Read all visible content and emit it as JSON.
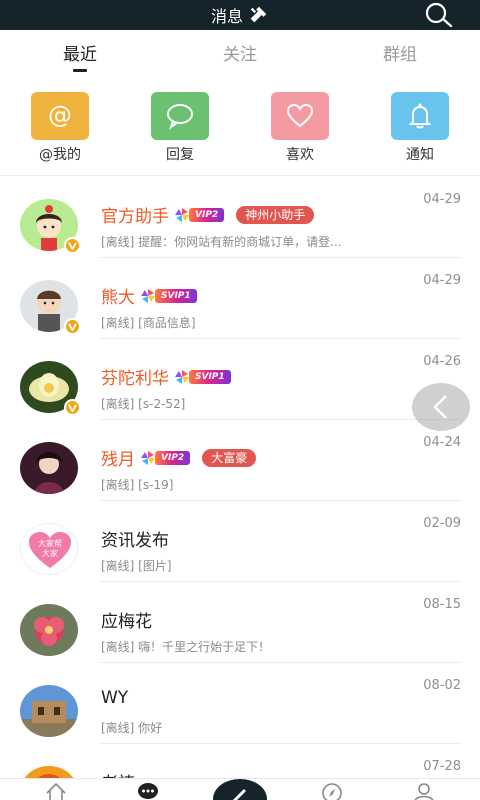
{
  "header": {
    "title": "消息"
  },
  "tabs": [
    {
      "label": "最近"
    },
    {
      "label": "关注"
    },
    {
      "label": "群组"
    }
  ],
  "quick_actions": [
    {
      "label": "@我的",
      "icon": "at-icon",
      "color": "#efb23c"
    },
    {
      "label": "回复",
      "icon": "chat-bubble-icon",
      "color": "#6cc072"
    },
    {
      "label": "喜欢",
      "icon": "heart-icon",
      "color": "#f39aa2"
    },
    {
      "label": "通知",
      "icon": "bell-icon",
      "color": "#68c4ec"
    }
  ],
  "messages": [
    {
      "name": "官方助手",
      "vip": "VIP2",
      "tag": "神州小助手",
      "preview": "[离线] 提醒：你网站有新的商城订单，请登...",
      "date": "04-29",
      "verified": true
    },
    {
      "name": "熊大",
      "vip": "SVIP1",
      "tag": "",
      "preview": "[离线] [商品信息]",
      "date": "04-29",
      "verified": true
    },
    {
      "name": "芬陀利华",
      "vip": "SVIP1",
      "tag": "",
      "preview": "[离线] [s-2-52]",
      "date": "04-26",
      "verified": true
    },
    {
      "name": "残月",
      "vip": "VIP2",
      "tag": "大富豪",
      "preview": "[离线] [s-19]",
      "date": "04-24",
      "verified": false
    },
    {
      "name": "资讯发布",
      "vip": "",
      "tag": "",
      "preview": "[离线] [图片]",
      "date": "02-09",
      "verified": false
    },
    {
      "name": "应梅花",
      "vip": "",
      "tag": "",
      "preview": "[离线] 嗨！千里之行始于足下！",
      "date": "08-15",
      "verified": false
    },
    {
      "name": "WY",
      "vip": "",
      "tag": "",
      "preview": "[离线] 你好",
      "date": "08-02",
      "verified": false
    },
    {
      "name": "老祷",
      "vip": "",
      "tag": "",
      "preview": "",
      "date": "07-28",
      "verified": false
    }
  ],
  "avatar_badge_text": "大家帮大家",
  "colors": {
    "topbar": "#15232b",
    "vip_name": "#ef5a26",
    "tag_red": "#e0574f",
    "verified": "#f0a81a"
  }
}
